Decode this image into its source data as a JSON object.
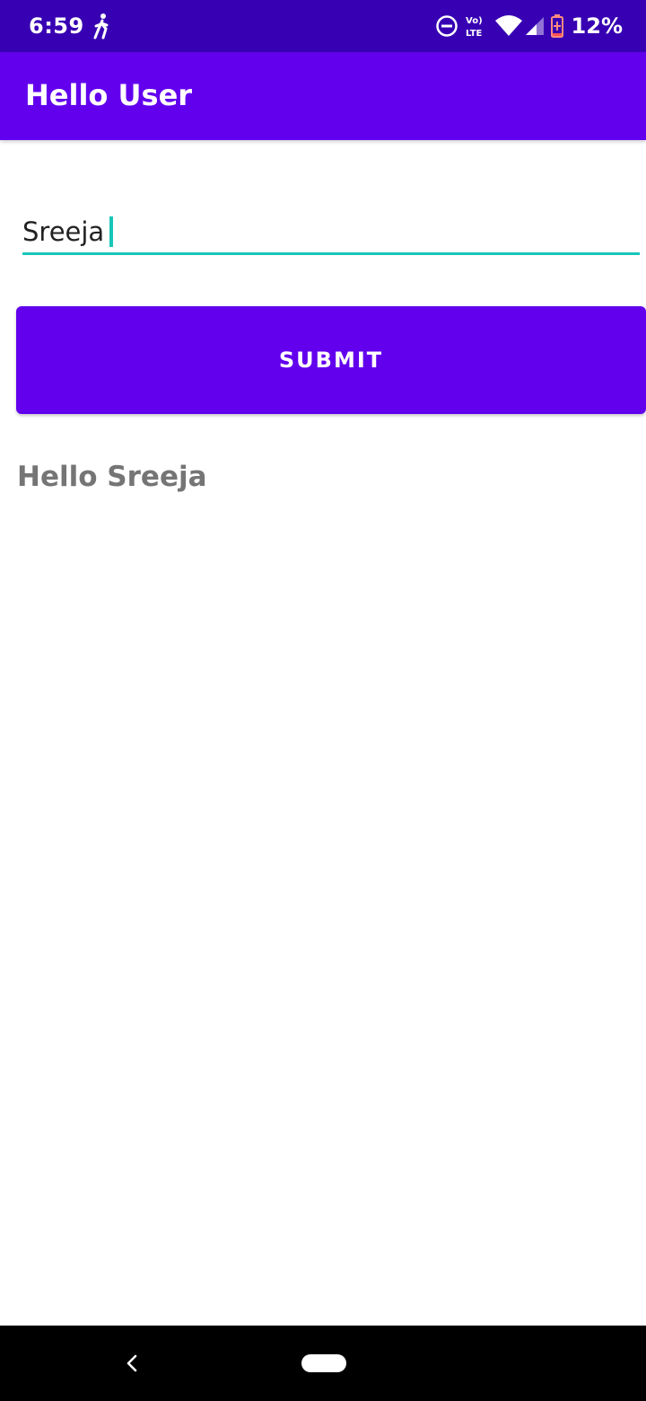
{
  "status_bar": {
    "time": "6:59",
    "battery_percent": "12%",
    "icons": [
      "walking-icon",
      "do-not-disturb-icon",
      "volte-icon",
      "wifi-icon",
      "signal-icon",
      "battery-low-icon"
    ]
  },
  "app_bar": {
    "title": "Hello User"
  },
  "form": {
    "name_input": {
      "value": "Sreeja"
    },
    "submit_label": "SUBMIT"
  },
  "output": {
    "greeting": "Hello Sreeja"
  },
  "nav_bar": {
    "icons": [
      "back-icon",
      "home-pill-icon"
    ]
  },
  "colors": {
    "status_bar": "#3700b3",
    "primary": "#6200ee",
    "accent": "#18c6b8",
    "greeting_text": "#757575"
  }
}
